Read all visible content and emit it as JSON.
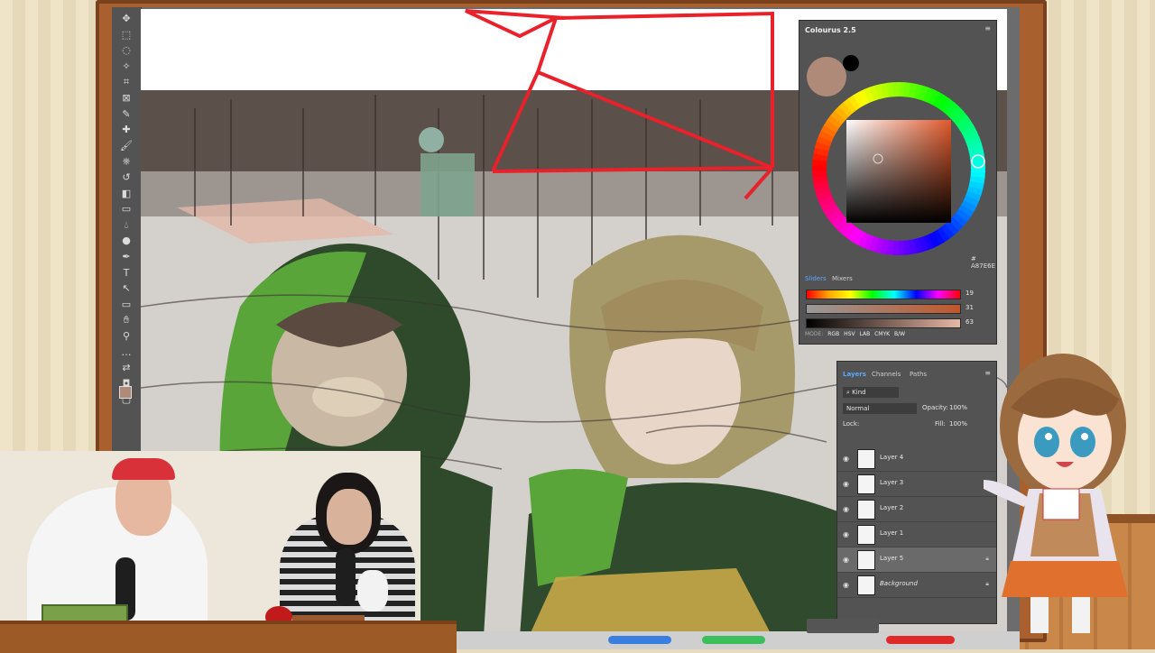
{
  "colorPanel": {
    "title": "Colourus 2.5",
    "hex": "# A87E6E",
    "tabs": [
      "Sliders",
      "Mixers"
    ],
    "sliders": [
      {
        "value": "19"
      },
      {
        "value": "31"
      },
      {
        "value": "63"
      }
    ],
    "modes": [
      "MODE:",
      "RGB",
      "HSV",
      "LAB",
      "CMYK",
      "B/W"
    ],
    "current_color": "#b08a79"
  },
  "layersPanel": {
    "tabs": [
      "Layers",
      "Channels",
      "Paths"
    ],
    "kind": "Kind",
    "blend": "Normal",
    "opacity_label": "Opacity:",
    "opacity_value": "100%",
    "lock_label": "Lock:",
    "fill_label": "Fill:",
    "fill_value": "100%",
    "layers": [
      {
        "name": "Layer 4"
      },
      {
        "name": "Layer 3"
      },
      {
        "name": "Layer 2"
      },
      {
        "name": "Layer 1"
      },
      {
        "name": "Layer 5"
      },
      {
        "name": "Background"
      }
    ]
  },
  "tools": [
    "move-icon",
    "marquee-icon",
    "lasso-icon",
    "magic-wand-icon",
    "crop-icon",
    "frame-icon",
    "eyedropper-icon",
    "healing-icon",
    "brush-icon",
    "stamp-icon",
    "history-brush-icon",
    "eraser-icon",
    "gradient-icon",
    "blur-icon",
    "dodge-icon",
    "pen-icon",
    "type-icon",
    "path-select-icon",
    "shape-icon",
    "hand-icon",
    "zoom-icon",
    "more-icon",
    "swap-colors-icon",
    "quick-mask-icon",
    "screen-mode-icon"
  ],
  "colors": {
    "accent": "#5aa8ff",
    "panel": "#535353",
    "frame_wood": "#a8612e",
    "sketch_red": "#e8212b",
    "hood_green": "#5aa53a"
  }
}
